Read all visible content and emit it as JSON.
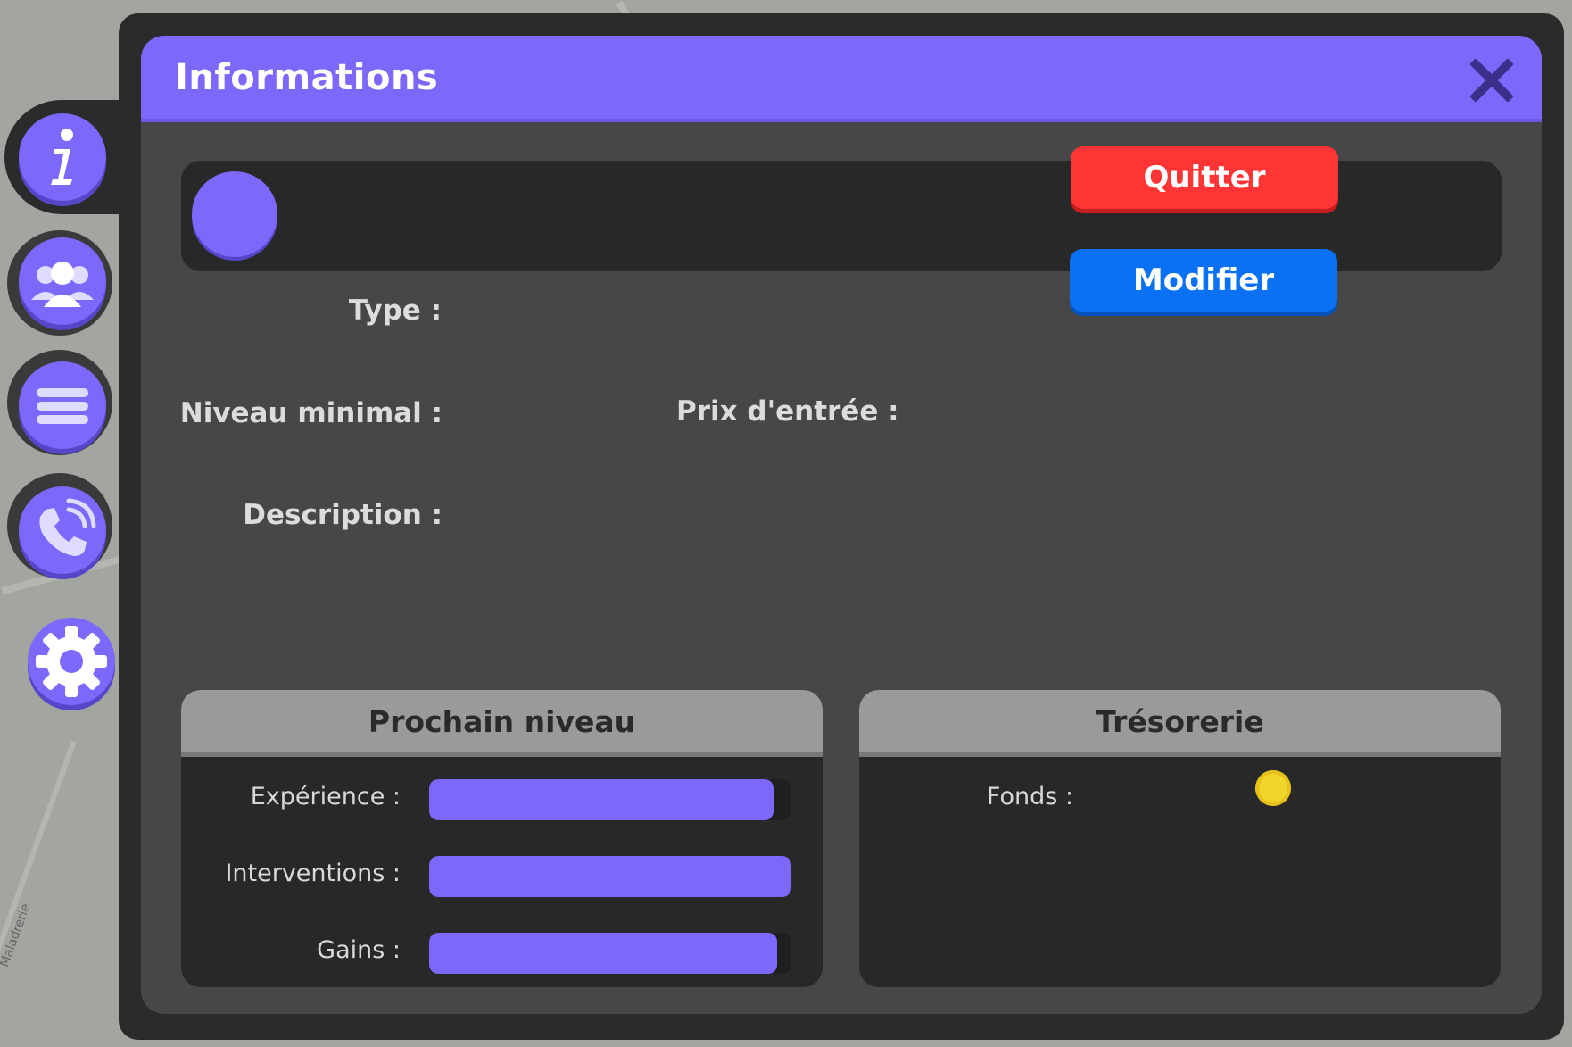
{
  "window": {
    "title": "Informations",
    "close_icon": "close-icon"
  },
  "buttons": {
    "quit": "Quitter",
    "edit": "Modifier"
  },
  "fields": {
    "type": "Type :",
    "min_level": "Niveau minimal :",
    "entry_price": "Prix d'entrée :",
    "description": "Description :"
  },
  "next_level": {
    "title": "Prochain niveau",
    "rows": [
      {
        "label": "Expérience :",
        "progress": 0.95
      },
      {
        "label": "Interventions :",
        "progress": 1.0
      },
      {
        "label": "Gains :",
        "progress": 0.96
      }
    ]
  },
  "treasury": {
    "title": "Trésorerie",
    "funds_label": "Fonds :",
    "coin_icon": "coin-icon"
  },
  "sidebar": {
    "items": [
      {
        "name": "info",
        "icon": "info-icon"
      },
      {
        "name": "members",
        "icon": "group-icon"
      },
      {
        "name": "list",
        "icon": "menu-icon"
      },
      {
        "name": "calls",
        "icon": "phone-icon"
      },
      {
        "name": "settings",
        "icon": "gear-icon"
      }
    ]
  },
  "map": {
    "street_label": "Maladrerie"
  },
  "colors": {
    "accent": "#7c68fb",
    "quit": "#ff3434",
    "edit": "#0a71f5",
    "panel": "#474747",
    "dark": "#282828"
  }
}
